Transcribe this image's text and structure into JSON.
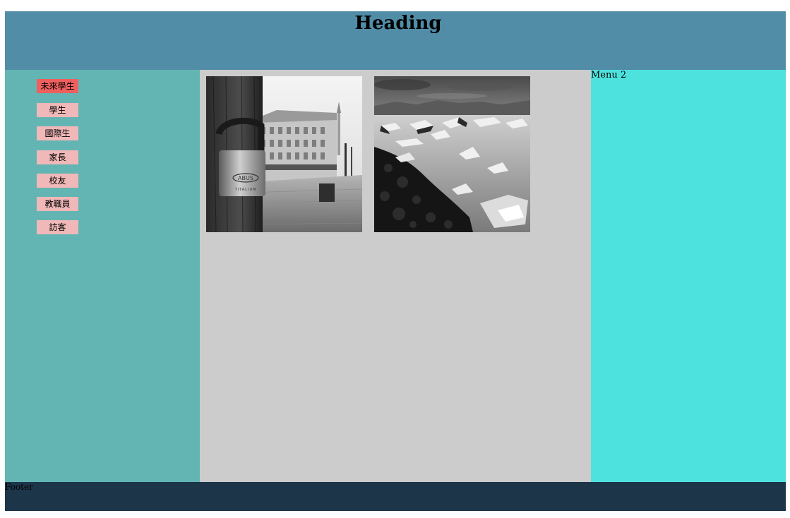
{
  "header": {
    "title": "Heading"
  },
  "left_menu": {
    "items": [
      {
        "label": "未來學生",
        "active": true
      },
      {
        "label": "學生",
        "active": false
      },
      {
        "label": "國際生",
        "active": false
      },
      {
        "label": "家長",
        "active": false
      },
      {
        "label": "校友",
        "active": false
      },
      {
        "label": "教職員",
        "active": false
      },
      {
        "label": "訪客",
        "active": false
      }
    ]
  },
  "main": {
    "images": [
      {
        "name": "padlock-street-photo",
        "lock_text": "ABUS",
        "lock_subtext": "TITALIUM"
      },
      {
        "name": "glacier-lagoon-photo"
      }
    ]
  },
  "right_menu": {
    "title": "Menu 2"
  },
  "footer": {
    "text": "Footer"
  },
  "colors": {
    "header_bg": "#518da7",
    "left_bg": "#63b5b3",
    "main_bg": "#cccccc",
    "right_bg": "#4ee2de",
    "footer_bg": "#1d3549",
    "menu_button": "#f0b8b8",
    "menu_button_active": "#f05f5f"
  }
}
